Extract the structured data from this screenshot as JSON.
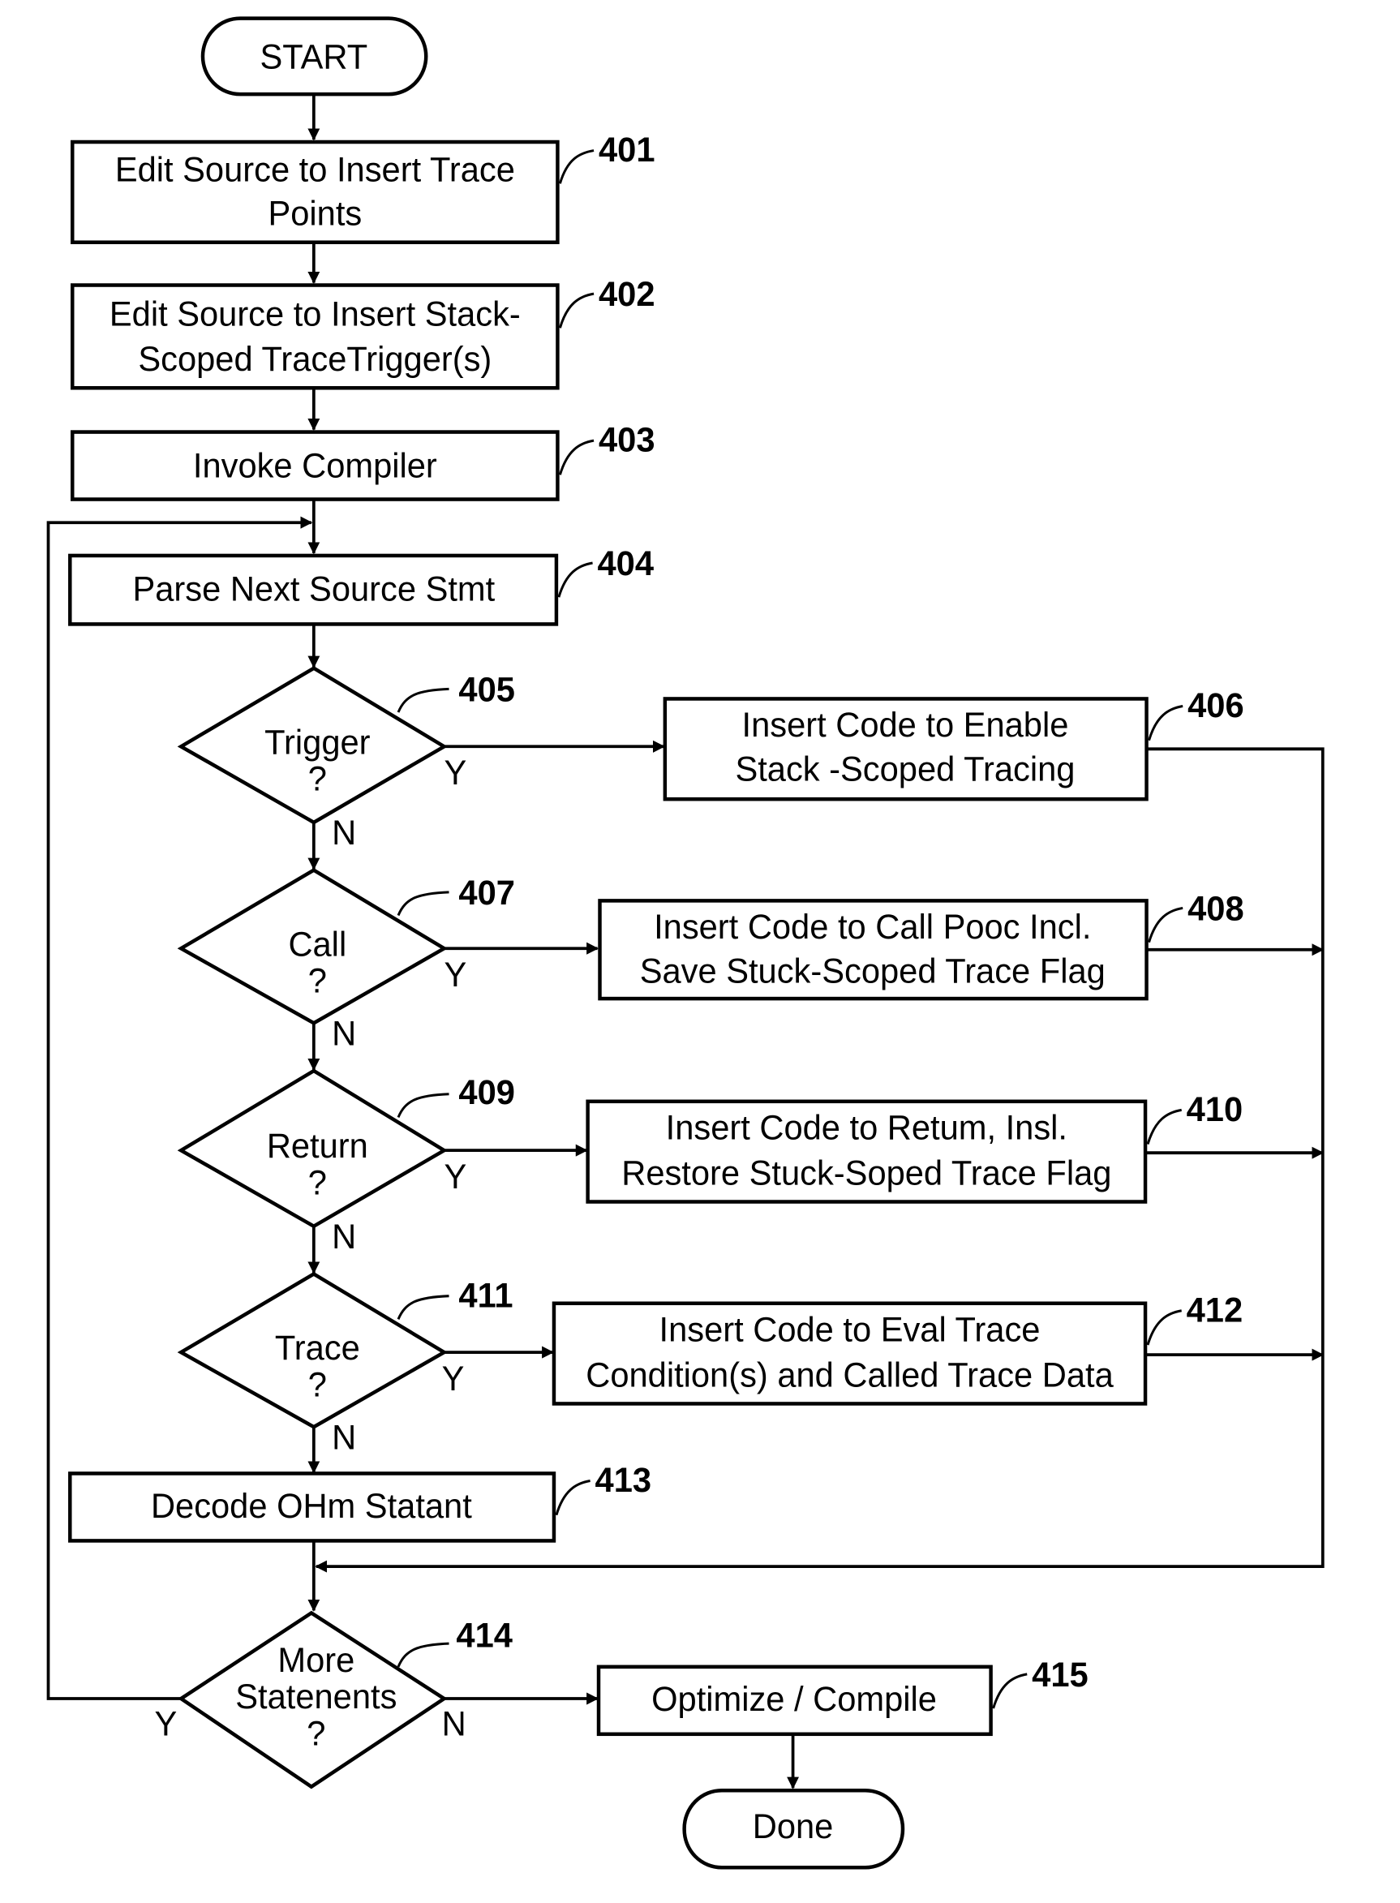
{
  "start": {
    "label": "START"
  },
  "end": {
    "label": "Done"
  },
  "steps": [
    {
      "ref": "401",
      "lines": [
        "Edit Source to Insert Trace",
        "Points"
      ]
    },
    {
      "ref": "402",
      "lines": [
        "Edit Source to Insert Stack-",
        "Scoped TraceTrigger(s)"
      ]
    },
    {
      "ref": "403",
      "lines": [
        "Invoke Compiler"
      ]
    },
    {
      "ref": "404",
      "lines": [
        "Parse Next Source Stmt"
      ]
    },
    {
      "ref": "406",
      "lines": [
        "Insert Code to Enable",
        "Stack -Scoped Tracing"
      ]
    },
    {
      "ref": "408",
      "lines": [
        "Insert Code to Call Pooc Incl.",
        "Save Stuck-Scoped Trace Flag"
      ]
    },
    {
      "ref": "410",
      "lines": [
        "Insert Code to Retum, Insl.",
        "Restore Stuck-Soped Trace Flag"
      ]
    },
    {
      "ref": "412",
      "lines": [
        "Insert Code to Eval Trace",
        "Condition(s) and Called Trace Data"
      ]
    },
    {
      "ref": "413",
      "lines": [
        "Decode OHm Statant"
      ]
    },
    {
      "ref": "415",
      "lines": [
        "Optimize / Compile"
      ]
    }
  ],
  "decisions": [
    {
      "ref": "405",
      "lines": [
        "Trigger",
        "?"
      ],
      "yes": "Y",
      "no": "N"
    },
    {
      "ref": "407",
      "lines": [
        "Call",
        "?"
      ],
      "yes": "Y",
      "no": "N"
    },
    {
      "ref": "409",
      "lines": [
        "Return",
        "?"
      ],
      "yes": "Y",
      "no": "N"
    },
    {
      "ref": "411",
      "lines": [
        "Trace",
        "?"
      ],
      "yes": "Y",
      "no": "N"
    },
    {
      "ref": "414",
      "lines": [
        "More",
        "Statenents",
        "?"
      ],
      "yes": "Y",
      "no": "N"
    }
  ]
}
